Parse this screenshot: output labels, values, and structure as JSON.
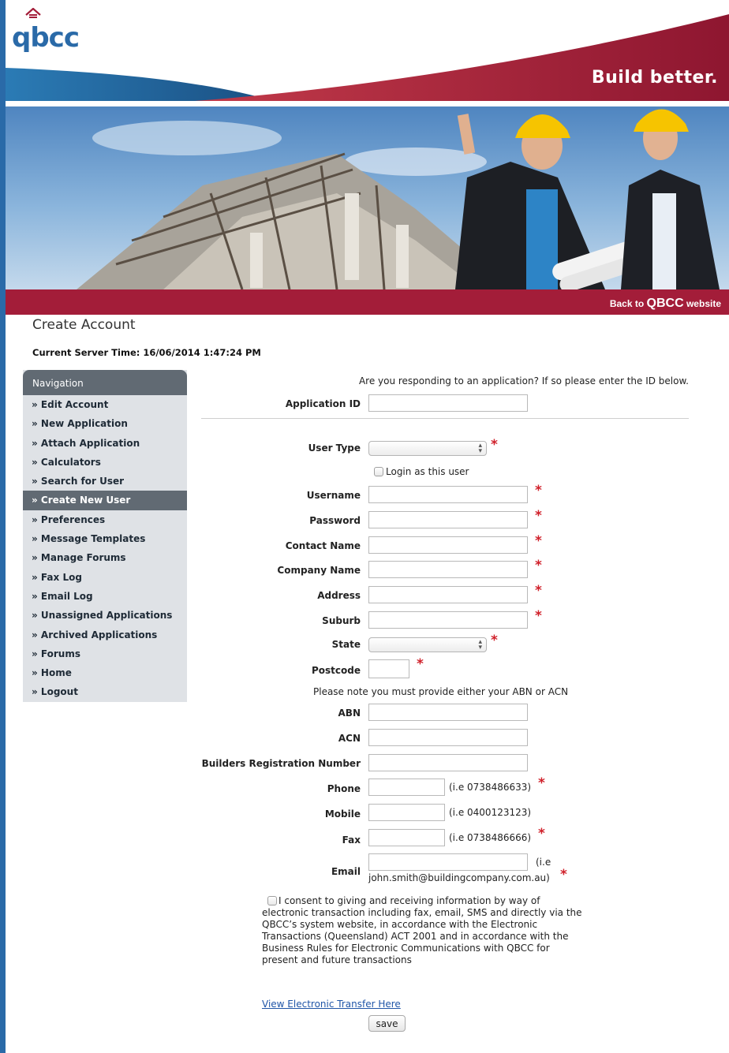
{
  "header": {
    "logo_text": "qbcc",
    "tagline": "Build better."
  },
  "banner": {
    "back_prefix": "Back to ",
    "back_brand": "QBCC",
    "back_suffix": " website"
  },
  "page": {
    "title": "Create Account",
    "server_time": "Current Server Time: 16/06/2014 1:47:24 PM"
  },
  "nav": {
    "heading": "Navigation",
    "items": [
      {
        "label": "» Edit Account"
      },
      {
        "label": "» New Application"
      },
      {
        "label": "» Attach Application"
      },
      {
        "label": "» Calculators"
      },
      {
        "label": "» Search for User"
      },
      {
        "label": "» Create New User",
        "active": true
      },
      {
        "label": "» Preferences"
      },
      {
        "label": "» Message Templates"
      },
      {
        "label": "» Manage Forums"
      },
      {
        "label": "» Fax Log"
      },
      {
        "label": "» Email Log"
      },
      {
        "label": "» Unassigned Applications"
      },
      {
        "label": "» Archived Applications"
      },
      {
        "label": "» Forums"
      },
      {
        "label": "» Home"
      },
      {
        "label": "» Logout"
      }
    ]
  },
  "form": {
    "intro": "Are you responding to an application? If so please enter the ID below.",
    "application_id_label": "Application ID",
    "user_type_label": "User Type",
    "login_as_label": "Login as this user",
    "username_label": "Username",
    "password_label": "Password",
    "contact_name_label": "Contact Name",
    "company_name_label": "Company Name",
    "address_label": "Address",
    "suburb_label": "Suburb",
    "state_label": "State",
    "postcode_label": "Postcode",
    "abn_acn_note": "Please note you must provide either your ABN or ACN",
    "abn_label": "ABN",
    "acn_label": "ACN",
    "builders_reg_label": "Builders Registration Number",
    "phone_label": "Phone",
    "phone_hint": "(i.e 0738486633)",
    "mobile_label": "Mobile",
    "mobile_hint": "(i.e 0400123123)",
    "fax_label": "Fax",
    "fax_hint": "(i.e 0738486666)",
    "email_label": "Email",
    "email_hint_1": "(i.e",
    "email_hint_2": "john.smith@buildingcompany.com.au)",
    "required_marker": "*",
    "consent_text": "I consent to giving and receiving information by way of electronic transaction including fax, email, SMS and directly via the QBCC’s system website, in accordance with the Electronic Transactions (Queensland) ACT 2001 and in accordance with the Business Rules for Electronic Communications with QBCC for present and future transactions",
    "view_link": "View Electronic Transfer Here",
    "save_label": "save"
  },
  "colors": {
    "brand_blue": "#2a6aa8",
    "brand_red": "#a31d39",
    "nav_dark": "#616a73",
    "required_red": "#d0202a"
  }
}
